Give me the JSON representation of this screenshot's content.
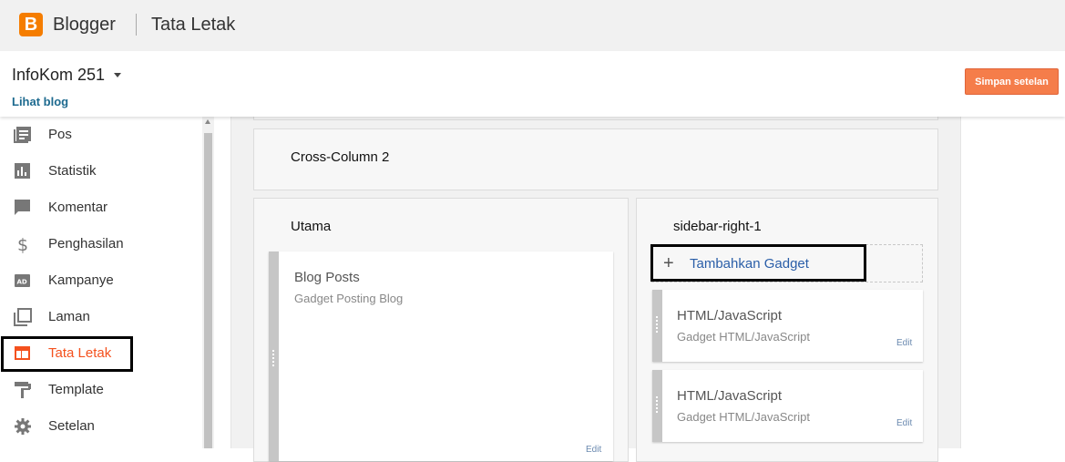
{
  "app": {
    "logo_glyph": "B",
    "name": "Blogger",
    "page_title": "Tata Letak"
  },
  "blog": {
    "name": "InfoKom 251",
    "view_link": "Lihat blog"
  },
  "toolbar": {
    "save_label": "Simpan setelan"
  },
  "sidebar": {
    "items": [
      {
        "label": "Pos",
        "icon": "posts-icon"
      },
      {
        "label": "Statistik",
        "icon": "stats-icon"
      },
      {
        "label": "Komentar",
        "icon": "comment-icon"
      },
      {
        "label": "Penghasilan",
        "icon": "dollar-icon"
      },
      {
        "label": "Kampanye",
        "icon": "ads-icon"
      },
      {
        "label": "Laman",
        "icon": "pages-icon"
      },
      {
        "label": "Tata Letak",
        "icon": "layout-icon",
        "active": true
      },
      {
        "label": "Template",
        "icon": "paint-roller-icon"
      },
      {
        "label": "Setelan",
        "icon": "gear-icon"
      }
    ],
    "active_color": "#f4511e"
  },
  "layout": {
    "cross_column_title": "Cross-Column 2",
    "main": {
      "title": "Utama",
      "gadgets": [
        {
          "title": "Blog Posts",
          "subtitle": "Gadget Posting Blog",
          "edit": "Edit"
        }
      ]
    },
    "sidebar_right": {
      "title": "sidebar-right-1",
      "add_label": "Tambahkan Gadget",
      "gadgets": [
        {
          "title": "HTML/JavaScript",
          "subtitle": "Gadget HTML/JavaScript",
          "edit": "Edit"
        },
        {
          "title": "HTML/JavaScript",
          "subtitle": "Gadget HTML/JavaScript",
          "edit": "Edit"
        }
      ]
    }
  },
  "colors": {
    "brand": "#f57d00",
    "save_button": "#f57d4a",
    "link": "#1d6a8f",
    "add_link": "#2a5ea8"
  }
}
